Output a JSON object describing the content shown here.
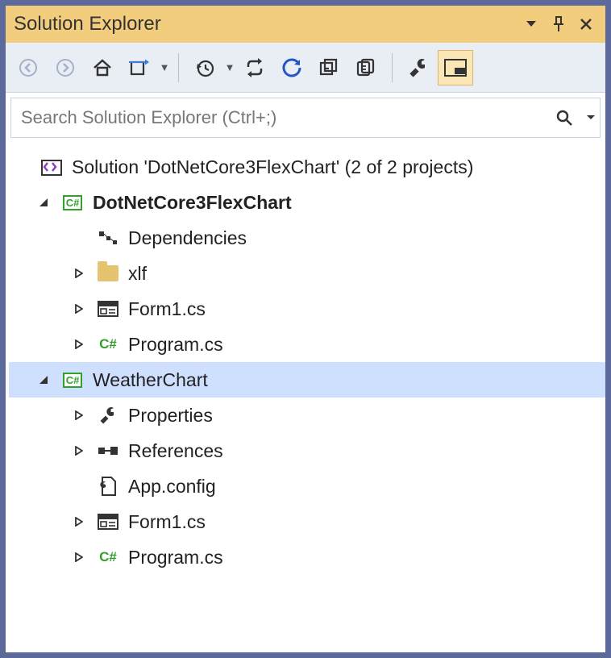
{
  "title": "Solution Explorer",
  "search": {
    "placeholder": "Search Solution Explorer (Ctrl+;)"
  },
  "tree": {
    "solution_label": "Solution 'DotNetCore3FlexChart' (2 of 2 projects)",
    "proj1": {
      "name": "DotNetCore3FlexChart",
      "dependencies": "Dependencies",
      "xlf": "xlf",
      "form1": "Form1.cs",
      "program": "Program.cs"
    },
    "proj2": {
      "name": "WeatherChart",
      "properties": "Properties",
      "references": "References",
      "appconfig": "App.config",
      "form1": "Form1.cs",
      "program": "Program.cs"
    }
  }
}
